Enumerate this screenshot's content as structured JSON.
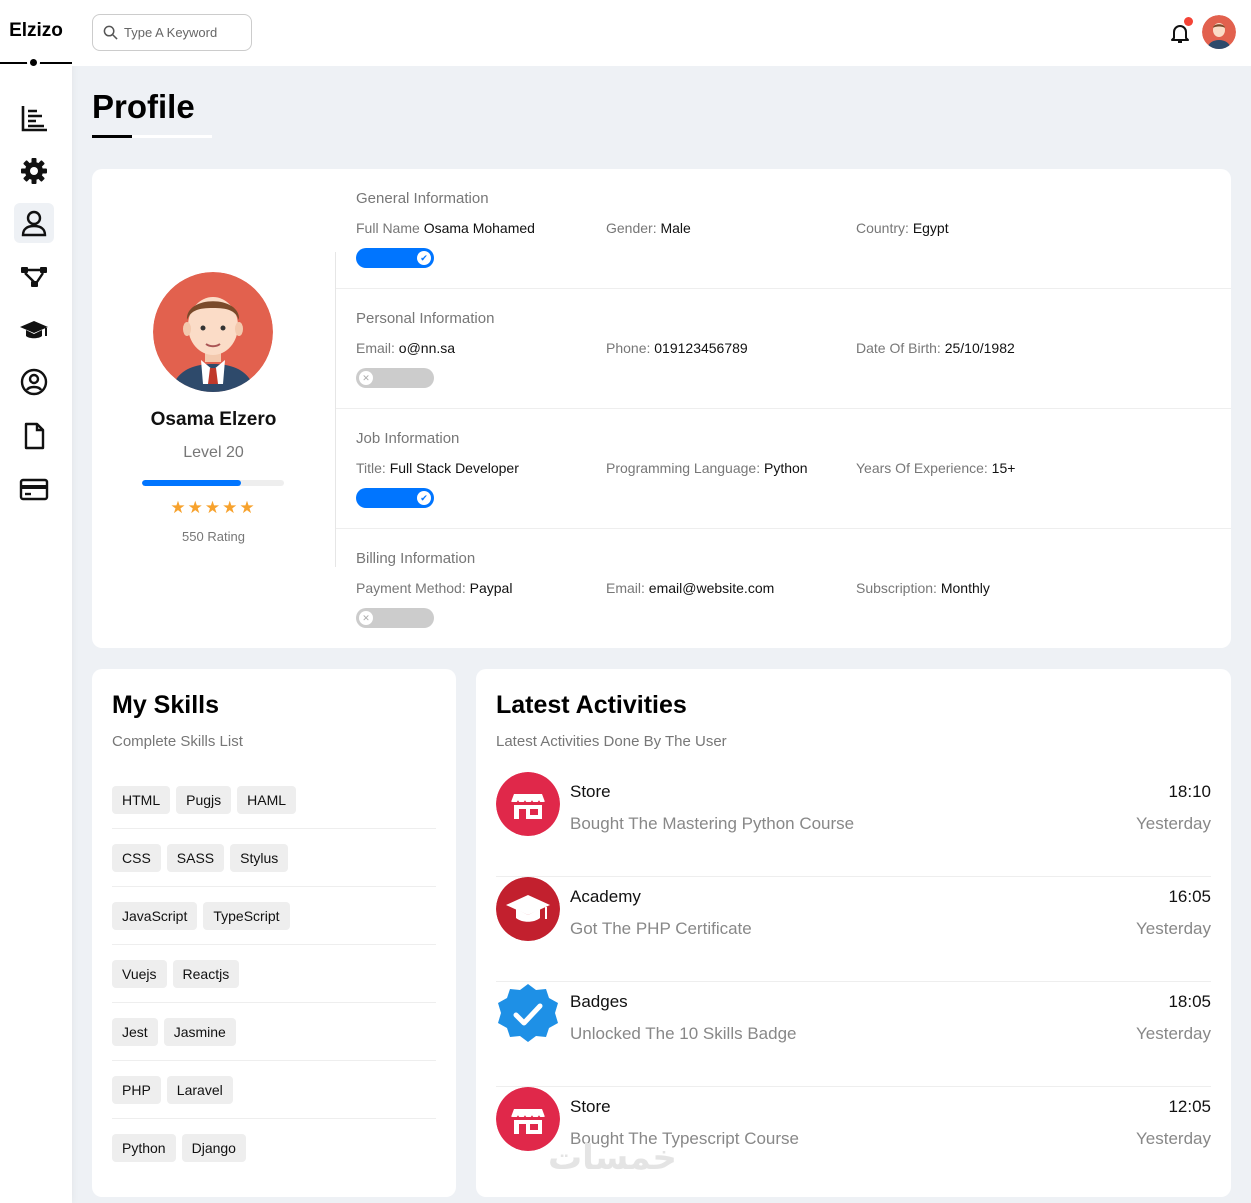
{
  "brand": "Elzizo",
  "search": {
    "placeholder": "Type A Keyword"
  },
  "page_title": "Profile",
  "sidebar": {
    "items": [
      {
        "name": "dashboard",
        "icon": "chart-icon"
      },
      {
        "name": "settings",
        "icon": "gear-icon"
      },
      {
        "name": "profile",
        "icon": "user-icon",
        "active": true
      },
      {
        "name": "projects",
        "icon": "diagram-icon"
      },
      {
        "name": "courses",
        "icon": "graduation-cap-icon"
      },
      {
        "name": "friends",
        "icon": "user-circle-icon"
      },
      {
        "name": "files",
        "icon": "file-icon"
      },
      {
        "name": "plans",
        "icon": "credit-card-icon"
      }
    ]
  },
  "profile": {
    "name": "Osama Elzero",
    "level": "Level 20",
    "level_progress": 0.7,
    "stars": "★★★★★",
    "rating": "550 Rating"
  },
  "info": {
    "general": {
      "heading": "General Information",
      "full_name_label": "Full Name",
      "full_name": "Osama Mohamed",
      "gender_label": "Gender:",
      "gender": "Male",
      "country_label": "Country:",
      "country": "Egypt",
      "toggle_on": true
    },
    "personal": {
      "heading": "Personal Information",
      "email_label": "Email:",
      "email": "o@nn.sa",
      "phone_label": "Phone:",
      "phone": "019123456789",
      "dob_label": "Date Of Birth:",
      "dob": "25/10/1982",
      "toggle_on": false
    },
    "job": {
      "heading": "Job Information",
      "title_label": "Title:",
      "title": "Full Stack Developer",
      "lang_label": "Programming Language:",
      "lang": "Python",
      "exp_label": "Years Of Experience:",
      "exp": "15+",
      "toggle_on": true
    },
    "billing": {
      "heading": "Billing Information",
      "method_label": "Payment Method:",
      "method": "Paypal",
      "email_label": "Email:",
      "email": "email@website.com",
      "sub_label": "Subscription:",
      "sub": "Monthly",
      "toggle_on": false
    }
  },
  "skills": {
    "title": "My Skills",
    "subtitle": "Complete Skills List",
    "rows": [
      [
        "HTML",
        "Pugjs",
        "HAML"
      ],
      [
        "CSS",
        "SASS",
        "Stylus"
      ],
      [
        "JavaScript",
        "TypeScript"
      ],
      [
        "Vuejs",
        "Reactjs"
      ],
      [
        "Jest",
        "Jasmine"
      ],
      [
        "PHP",
        "Laravel"
      ],
      [
        "Python",
        "Django"
      ]
    ]
  },
  "activities": {
    "title": "Latest Activities",
    "subtitle": "Latest Activities Done By The User",
    "items": [
      {
        "icon": "store-icon",
        "title": "Store",
        "desc": "Bought The Mastering Python Course",
        "time": "18:10",
        "day": "Yesterday"
      },
      {
        "icon": "graduation-cap-icon",
        "title": "Academy",
        "desc": "Got The PHP Certificate",
        "time": "16:05",
        "day": "Yesterday"
      },
      {
        "icon": "badge-check-icon",
        "title": "Badges",
        "desc": "Unlocked The 10 Skills Badge",
        "time": "18:05",
        "day": "Yesterday"
      },
      {
        "icon": "store-icon",
        "title": "Store",
        "desc": "Bought The Typescript Course",
        "time": "12:05",
        "day": "Yesterday"
      }
    ]
  },
  "watermark": "خمسات",
  "colors": {
    "accent": "#0075ff",
    "star": "#f7a22d",
    "notification": "#f44336",
    "store": "#e0284a",
    "academy": "#c2202e",
    "badge": "#1e90e6"
  }
}
